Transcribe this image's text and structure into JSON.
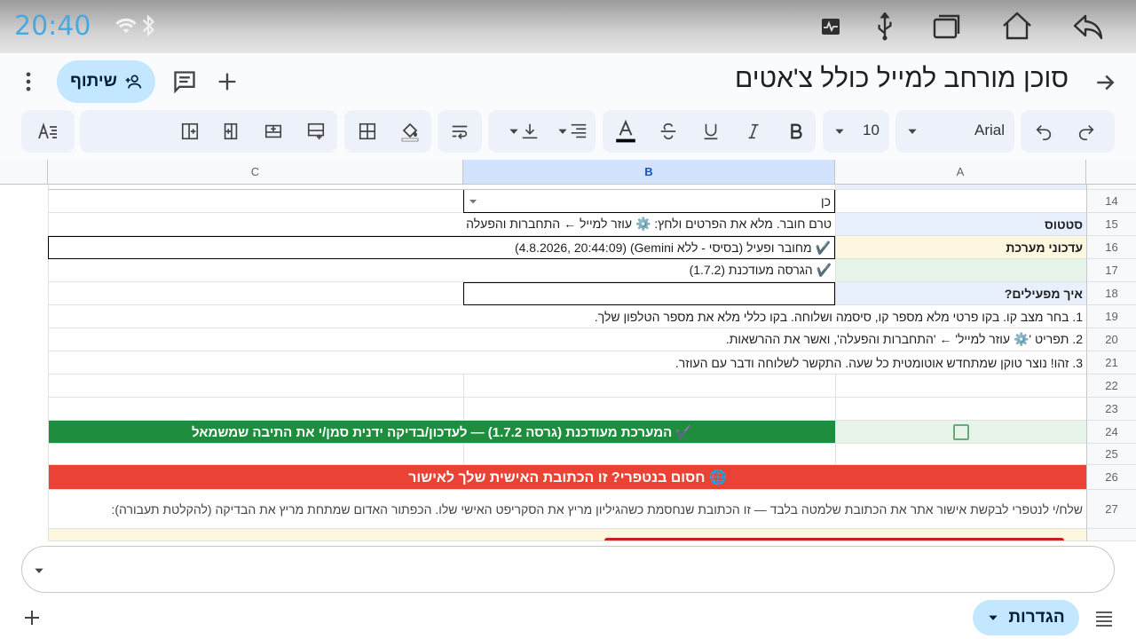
{
  "status_bar": {
    "time": "20:40"
  },
  "app_bar": {
    "title": "סוכן מורחב למייל כולל צ'אטים",
    "share_label": "שיתוף"
  },
  "toolbar": {
    "font_name": "Arial",
    "font_size": "10"
  },
  "columns": [
    "A",
    "B",
    "C"
  ],
  "colors": {
    "selected_column": "#d3e3fd",
    "banner_green": "#1e8e3e",
    "banner_red": "#ea4335",
    "share_bg": "#c2e7ff",
    "clock": "#4aa8e0"
  },
  "rows": [
    {
      "num": "14",
      "b": "כן",
      "a": ""
    },
    {
      "num": "15",
      "a": "סטטוס",
      "merged": "טרם חובר. מלא את הפרטים ולחץ: ⚙️ עוזר למייל ← התחברות והפעלה"
    },
    {
      "num": "16",
      "a": "עדכוני מערכת",
      "merged": "✔️ מחובר ופעיל (בסיסי - ללא Gemini)  (4.8.2026, 20:44:09)"
    },
    {
      "num": "17",
      "a": "",
      "merged": "✔️ הגרסה מעודכנת (1.7.2)"
    },
    {
      "num": "18",
      "a": "איך מפעילים?",
      "b": ""
    },
    {
      "num": "19",
      "a": "1. בחר מצב קו. בקו פרטי מלא מספר קו, סיסמה ושלוחה. בקו כללי מלא את מספר הטלפון שלך."
    },
    {
      "num": "20",
      "a": "2. תפריט '⚙️ עוזר למייל' ← 'התחברות והפעלה', ואשר את ההרשאות."
    },
    {
      "num": "21",
      "a": "3. זהו! נוצר טוקן שמתחדש אוטומטית כל שעה. התקשר לשלוחה ודבר עם העוזר."
    },
    {
      "num": "22"
    },
    {
      "num": "23"
    },
    {
      "num": "24",
      "merged": "✔️ המערכת מעודכנת (גרסה 1.7.2) — לעדכון/בדיקה ידנית סמן/י את התיבה שמשמאל"
    },
    {
      "num": "25"
    },
    {
      "num": "26",
      "merged": "🌐 חסום בנטפרי? זו הכתובת האישית שלך לאישור"
    },
    {
      "num": "27",
      "a": "שלח/י לנטפרי לבקשת אישור אתר את הכתובת שלמטה בלבד — זו הכתובת שנחסמת כשהגיליון מריץ את הסקריפט האישי שלו. הכפתור האדום שמתחת מריץ את הבדיקה (להקלטת תעבורה):"
    }
  ],
  "bottom_bar": {
    "sheet_label": "הגדרות"
  }
}
